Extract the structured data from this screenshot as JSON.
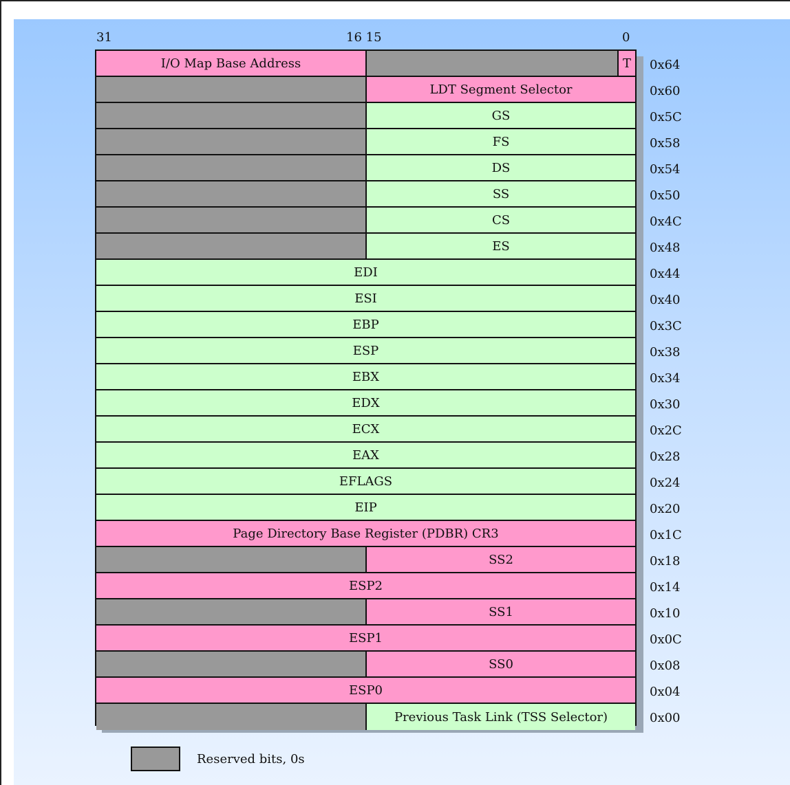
{
  "bit_labels": {
    "b31": "31",
    "b16_15": "16 15",
    "b0": "0"
  },
  "rows": [
    {
      "offset": "0x64",
      "high": {
        "label": "I/O Map Base Address",
        "color": "pink"
      },
      "low": {
        "label": "",
        "color": "gray"
      },
      "t_bit": "T"
    },
    {
      "offset": "0x60",
      "high": {
        "label": "",
        "color": "gray"
      },
      "low": {
        "label": "LDT Segment Selector",
        "color": "pink"
      }
    },
    {
      "offset": "0x5C",
      "high": {
        "label": "",
        "color": "gray"
      },
      "low": {
        "label": "GS",
        "color": "green"
      }
    },
    {
      "offset": "0x58",
      "high": {
        "label": "",
        "color": "gray"
      },
      "low": {
        "label": "FS",
        "color": "green"
      }
    },
    {
      "offset": "0x54",
      "high": {
        "label": "",
        "color": "gray"
      },
      "low": {
        "label": "DS",
        "color": "green"
      }
    },
    {
      "offset": "0x50",
      "high": {
        "label": "",
        "color": "gray"
      },
      "low": {
        "label": "SS",
        "color": "green"
      }
    },
    {
      "offset": "0x4C",
      "high": {
        "label": "",
        "color": "gray"
      },
      "low": {
        "label": "CS",
        "color": "green"
      }
    },
    {
      "offset": "0x48",
      "high": {
        "label": "",
        "color": "gray"
      },
      "low": {
        "label": "ES",
        "color": "green"
      }
    },
    {
      "offset": "0x44",
      "full": {
        "label": "EDI",
        "color": "green"
      }
    },
    {
      "offset": "0x40",
      "full": {
        "label": "ESI",
        "color": "green"
      }
    },
    {
      "offset": "0x3C",
      "full": {
        "label": "EBP",
        "color": "green"
      }
    },
    {
      "offset": "0x38",
      "full": {
        "label": "ESP",
        "color": "green"
      }
    },
    {
      "offset": "0x34",
      "full": {
        "label": "EBX",
        "color": "green"
      }
    },
    {
      "offset": "0x30",
      "full": {
        "label": "EDX",
        "color": "green"
      }
    },
    {
      "offset": "0x2C",
      "full": {
        "label": "ECX",
        "color": "green"
      }
    },
    {
      "offset": "0x28",
      "full": {
        "label": "EAX",
        "color": "green"
      }
    },
    {
      "offset": "0x24",
      "full": {
        "label": "EFLAGS",
        "color": "green"
      }
    },
    {
      "offset": "0x20",
      "full": {
        "label": "EIP",
        "color": "green"
      }
    },
    {
      "offset": "0x1C",
      "full": {
        "label": "Page Directory Base Register (PDBR) CR3",
        "color": "pink"
      }
    },
    {
      "offset": "0x18",
      "high": {
        "label": "",
        "color": "gray"
      },
      "low": {
        "label": "SS2",
        "color": "pink"
      }
    },
    {
      "offset": "0x14",
      "full": {
        "label": "ESP2",
        "color": "pink"
      }
    },
    {
      "offset": "0x10",
      "high": {
        "label": "",
        "color": "gray"
      },
      "low": {
        "label": "SS1",
        "color": "pink"
      }
    },
    {
      "offset": "0x0C",
      "full": {
        "label": "ESP1",
        "color": "pink"
      }
    },
    {
      "offset": "0x08",
      "high": {
        "label": "",
        "color": "gray"
      },
      "low": {
        "label": "SS0",
        "color": "pink"
      }
    },
    {
      "offset": "0x04",
      "full": {
        "label": "ESP0",
        "color": "pink"
      }
    },
    {
      "offset": "0x00",
      "high": {
        "label": "",
        "color": "gray"
      },
      "low": {
        "label": "Previous Task Link (TSS Selector)",
        "color": "green"
      }
    }
  ],
  "legend": {
    "label": "Reserved bits, 0s"
  },
  "colors": {
    "pink": "#ff99cc",
    "green": "#ccffcc",
    "gray": "#999999"
  }
}
